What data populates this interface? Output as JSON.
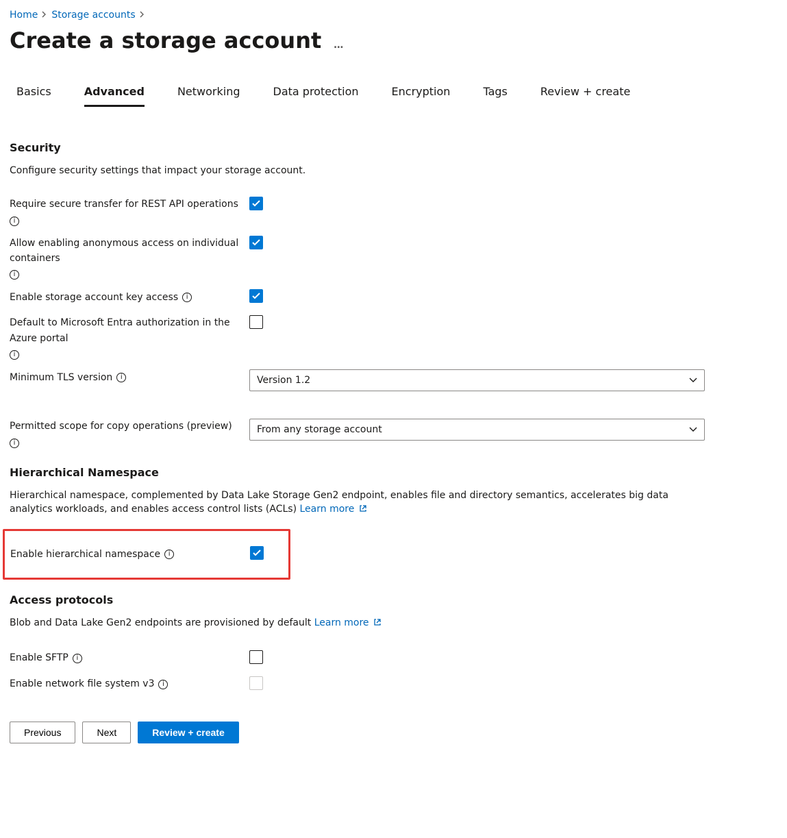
{
  "breadcrumb": {
    "home": "Home",
    "storage_accounts": "Storage accounts"
  },
  "page": {
    "title": "Create a storage account",
    "more": "…"
  },
  "tabs": {
    "basics": "Basics",
    "advanced": "Advanced",
    "networking": "Networking",
    "data_protection": "Data protection",
    "encryption": "Encryption",
    "tags": "Tags",
    "review": "Review + create",
    "active": "advanced"
  },
  "security": {
    "title": "Security",
    "desc": "Configure security settings that impact your storage account.",
    "require_secure_label": "Require secure transfer for REST API operations",
    "allow_anon_label": "Allow enabling anonymous access on individual containers",
    "enable_key_label": "Enable storage account key access",
    "entra_label": "Default to Microsoft Entra authorization in the Azure portal",
    "tls_label": "Minimum TLS version",
    "tls_value": "Version 1.2",
    "copy_scope_label": "Permitted scope for copy operations (preview)",
    "copy_scope_value": "From any storage account"
  },
  "hns": {
    "title": "Hierarchical Namespace",
    "desc": "Hierarchical namespace, complemented by Data Lake Storage Gen2 endpoint, enables file and directory semantics, accelerates big data analytics workloads, and enables access control lists (ACLs)",
    "learn_more": "Learn more",
    "enable_label": "Enable hierarchical namespace"
  },
  "protocols": {
    "title": "Access protocols",
    "desc": "Blob and Data Lake Gen2 endpoints are provisioned by default",
    "learn_more": "Learn more",
    "sftp_label": "Enable SFTP",
    "nfs_label": "Enable network file system v3"
  },
  "footer": {
    "previous": "Previous",
    "next": "Next",
    "review": "Review + create"
  },
  "icons": {
    "info_glyph": "i"
  }
}
